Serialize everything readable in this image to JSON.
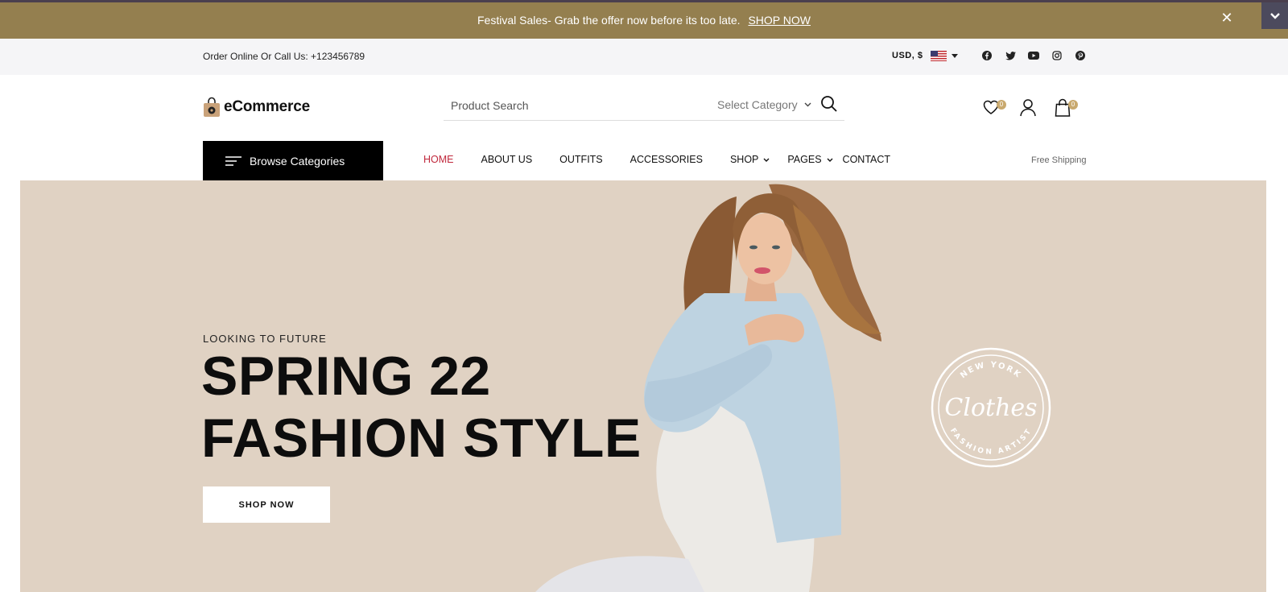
{
  "promo": {
    "message": "Festival Sales- Grab the offer now before its too late.",
    "link": "SHOP NOW",
    "close_icon": "close-icon",
    "toggle_icon": "chevron-down-icon"
  },
  "topbar": {
    "contact": "Order Online Or Call Us: +123456789",
    "currency": "USD, $",
    "flag_icon": "us-flag-icon",
    "social_icons": [
      "facebook-icon",
      "twitter-icon",
      "youtube-icon",
      "instagram-icon",
      "pinterest-icon"
    ]
  },
  "header": {
    "logo_text": "eCommerce",
    "search_placeholder": "Product Search",
    "category_label": "Select Category",
    "wishlist_count": "0",
    "cart_count": "0"
  },
  "nav": {
    "browse_label": "Browse Categories",
    "items": [
      {
        "label": "HOME"
      },
      {
        "label": "ABOUT US"
      },
      {
        "label": "OUTFITS"
      },
      {
        "label": "ACCESSORIES"
      },
      {
        "label": "SHOP"
      },
      {
        "label": "PAGES"
      },
      {
        "label": "CONTACT"
      }
    ],
    "free_shipping": "Free Shipping"
  },
  "hero": {
    "eyebrow": "LOOKING TO FUTURE",
    "line1": "SPRING 22",
    "line2": "FASHION STYLE",
    "button": "SHOP NOW",
    "stamp_top": "NEW YORK",
    "stamp_script": "Clothes",
    "stamp_bottom": "FASHION ARTIST"
  },
  "colors": {
    "promo_bg": "#947f4f",
    "topbar_bg": "#f5f5f7",
    "hero_bg": "#e0d2c3",
    "accent_active": "#c0283c",
    "badge": "#c9a96e"
  }
}
